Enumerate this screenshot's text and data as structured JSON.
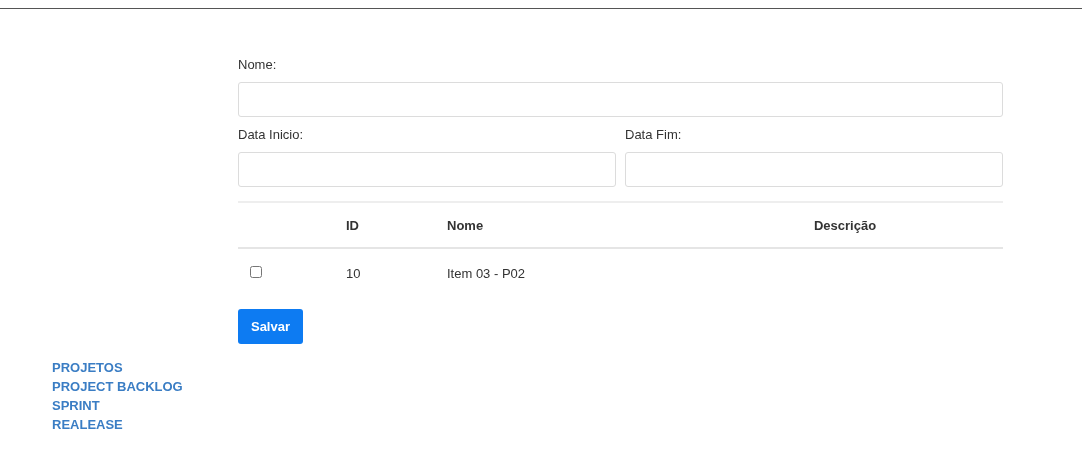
{
  "form": {
    "fields": [
      {
        "label": "Nome:"
      }
    ],
    "date_fields": [
      {
        "label": "Data Inicio:"
      },
      {
        "label": "Data Fim:"
      }
    ]
  },
  "table": {
    "columns": [
      "ID",
      "Nome",
      "Descrição"
    ],
    "rows": [
      {
        "checked": false,
        "id": "10",
        "nome": "Item 03 - P02"
      }
    ]
  },
  "save_button": "Salvar",
  "nav": [
    "PROJETOS",
    "PROJECT BACKLOG",
    "SPRINT",
    "REALEASE"
  ]
}
